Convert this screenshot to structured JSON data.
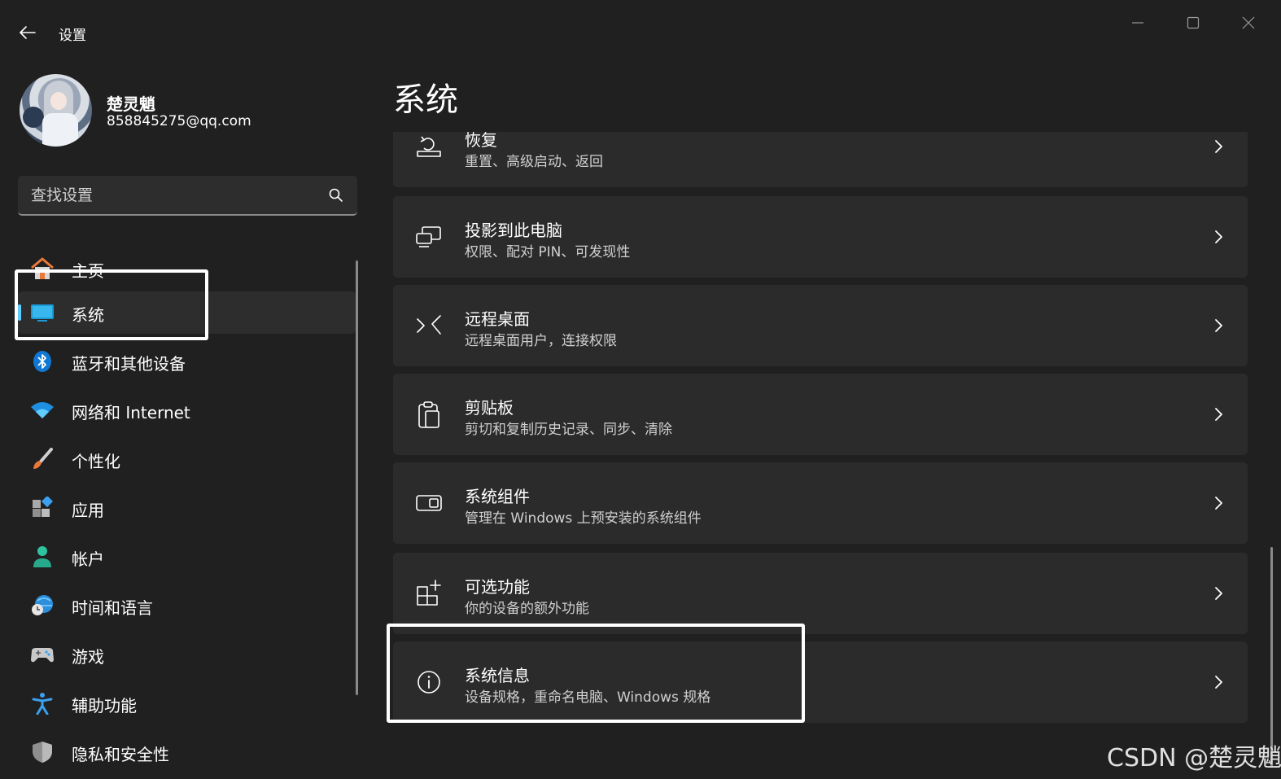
{
  "window": {
    "title": "设置"
  },
  "profile": {
    "name": "楚灵魈",
    "email": "858845275@qq.com"
  },
  "search": {
    "placeholder": "查找设置"
  },
  "nav": {
    "items": [
      {
        "label": "主页",
        "icon": "home-icon"
      },
      {
        "label": "系统",
        "icon": "system-monitor-icon",
        "selected": true
      },
      {
        "label": "蓝牙和其他设备",
        "icon": "bluetooth-icon"
      },
      {
        "label": "网络和 Internet",
        "icon": "wifi-icon"
      },
      {
        "label": "个性化",
        "icon": "paintbrush-icon"
      },
      {
        "label": "应用",
        "icon": "apps-icon"
      },
      {
        "label": "帐户",
        "icon": "account-icon"
      },
      {
        "label": "时间和语言",
        "icon": "time-language-icon"
      },
      {
        "label": "游戏",
        "icon": "gamepad-icon"
      },
      {
        "label": "辅助功能",
        "icon": "accessibility-icon"
      },
      {
        "label": "隐私和安全性",
        "icon": "shield-icon"
      }
    ]
  },
  "main": {
    "title": "系统",
    "cards": [
      {
        "title": "恢复",
        "desc": "重置、高级启动、返回",
        "icon": "recovery-icon"
      },
      {
        "title": "投影到此电脑",
        "desc": "权限、配对 PIN、可发现性",
        "icon": "project-icon"
      },
      {
        "title": "远程桌面",
        "desc": "远程桌面用户，连接权限",
        "icon": "remote-desktop-icon"
      },
      {
        "title": "剪贴板",
        "desc": "剪切和复制历史记录、同步、清除",
        "icon": "clipboard-icon"
      },
      {
        "title": "系统组件",
        "desc": "管理在 Windows 上预安装的系统组件",
        "icon": "system-components-icon"
      },
      {
        "title": "可选功能",
        "desc": "你的设备的额外功能",
        "icon": "optional-features-icon"
      },
      {
        "title": "系统信息",
        "desc": "设备规格，重命名电脑、Windows 规格",
        "icon": "info-icon"
      }
    ]
  },
  "colors": {
    "accent": "#60cdff",
    "background": "#202020",
    "card": "#2b2b2b"
  },
  "watermark": "CSDN @楚灵魈"
}
